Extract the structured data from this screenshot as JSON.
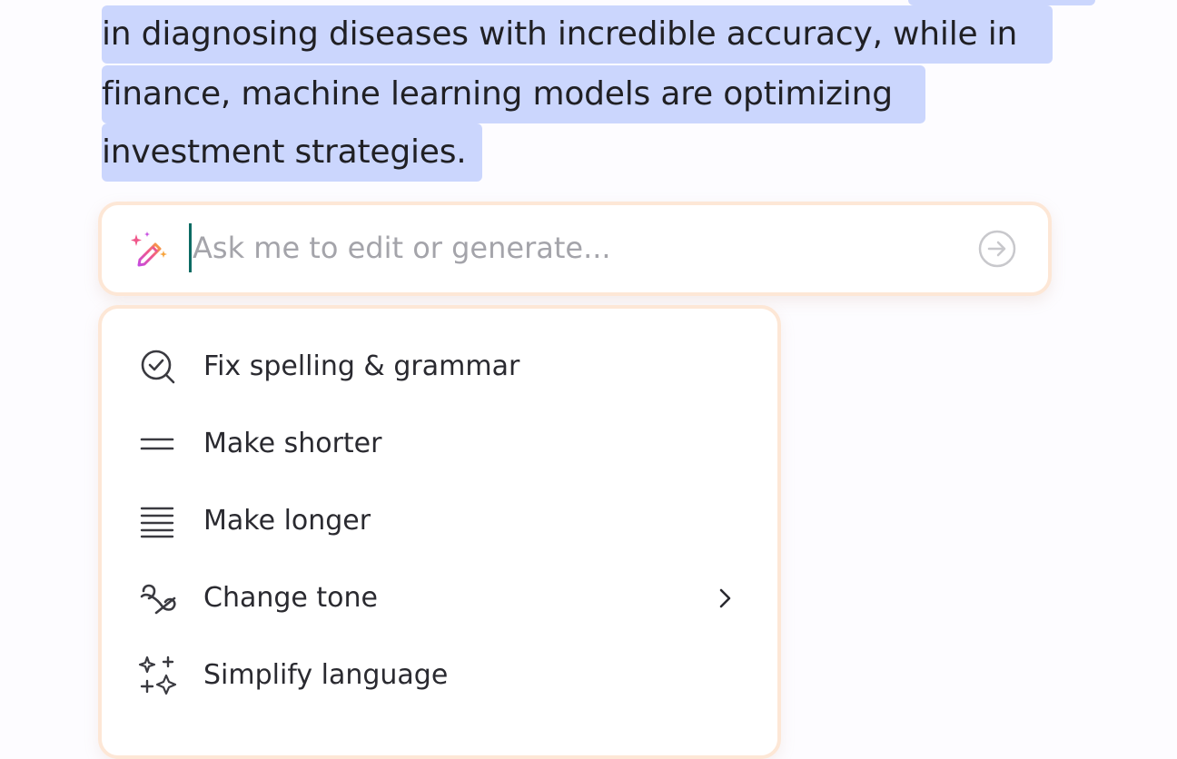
{
  "document": {
    "lines": [
      "in diagnosing diseases with incredible accuracy, while in",
      "finance, machine learning models are optimizing",
      "investment strategies."
    ]
  },
  "ai_prompt": {
    "placeholder": "Ask me to edit or generate...",
    "value": "",
    "icon": "magic-wand-icon",
    "send_icon": "arrow-right-circle-icon"
  },
  "menu": {
    "items": [
      {
        "label": "Fix spelling & grammar",
        "icon": "spell-check-icon"
      },
      {
        "label": "Make shorter",
        "icon": "short-lines-icon"
      },
      {
        "label": "Make longer",
        "icon": "long-lines-icon"
      },
      {
        "label": "Change tone",
        "icon": "tone-icon",
        "has_submenu": true
      },
      {
        "label": "Simplify language",
        "icon": "sparkles-icon"
      }
    ]
  },
  "colors": {
    "selection": "#cbd6fd",
    "accent_border": "#fde7d6",
    "caret": "#0c6b63"
  }
}
